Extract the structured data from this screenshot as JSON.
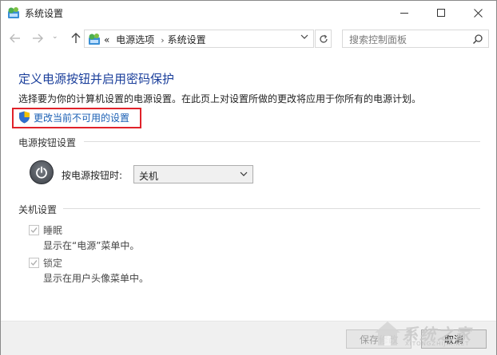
{
  "window": {
    "title": "系统设置"
  },
  "nav": {
    "recent_symbol": "⌄",
    "breadcrumb_overflow": "«",
    "breadcrumb": [
      "电源选项",
      "系统设置"
    ],
    "search_placeholder": "搜索控制面板"
  },
  "content": {
    "heading": "定义电源按钮并启用密码保护",
    "description": "选择要为你的计算机设置的电源设置。在此页上对设置所做的更改将应用于你所有的电源计划。",
    "change_link": "更改当前不可用的设置",
    "power_section": {
      "title": "电源按钮设置",
      "label": "按电源按钮时:",
      "selected": "关机"
    },
    "shutdown_section": {
      "title": "关机设置",
      "items": [
        {
          "label": "睡眠",
          "desc": "显示在“电源”菜单中。",
          "checked": true
        },
        {
          "label": "锁定",
          "desc": "显示在用户头像菜单中。",
          "checked": true
        }
      ]
    }
  },
  "footer": {
    "save_label": "保存修改",
    "cancel_label": "取消"
  },
  "watermark": {
    "text": "系统之家",
    "sub": "XITONGZHIJIA.NET"
  },
  "colors": {
    "heading": "#1b3f9b",
    "link": "#1a5fb4",
    "highlight": "#e0222a"
  },
  "icons": [
    "control-panel-icon",
    "minimize-icon",
    "maximize-icon",
    "close-icon",
    "back-arrow-icon",
    "forward-arrow-icon",
    "up-arrow-icon",
    "refresh-icon",
    "search-icon",
    "shield-icon",
    "power-icon",
    "chevron-down-icon",
    "checkmark-icon"
  ]
}
